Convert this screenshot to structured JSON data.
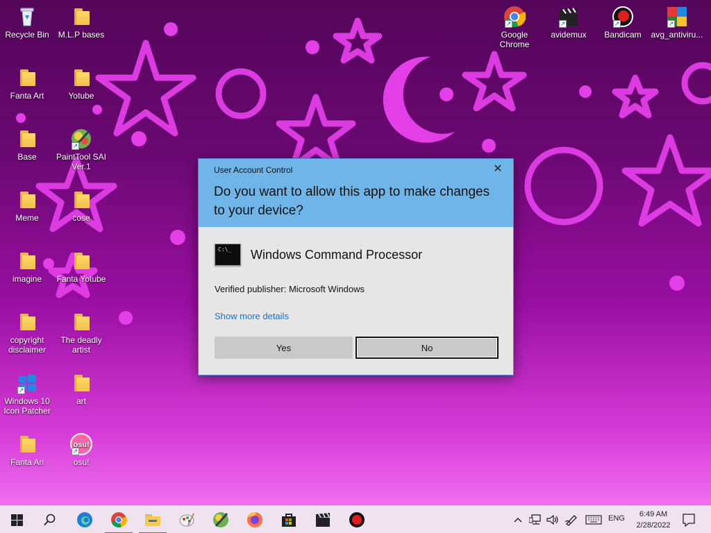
{
  "desktop": {
    "icons_left": [
      {
        "label": "Recycle Bin",
        "type": "recycle"
      },
      {
        "label": "M.L.P bases",
        "type": "folder"
      },
      {
        "label": "Fanta Art",
        "type": "folder"
      },
      {
        "label": "Yotube",
        "type": "folder"
      },
      {
        "label": "Base",
        "type": "folder"
      },
      {
        "label": "PaintTool SAI Ver.1",
        "type": "app"
      },
      {
        "label": "Meme",
        "type": "folder"
      },
      {
        "label": "cose",
        "type": "folder"
      },
      {
        "label": "imagine",
        "type": "folder"
      },
      {
        "label": "Fanta Yotube",
        "type": "folder"
      },
      {
        "label": "copyright disclaimer",
        "type": "folder"
      },
      {
        "label": "The deadly artist",
        "type": "folder"
      },
      {
        "label": "Windows 10 Icon Patcher",
        "type": "app"
      },
      {
        "label": "art",
        "type": "folder"
      },
      {
        "label": "Fanta Ari",
        "type": "folder"
      },
      {
        "label": "osu!",
        "type": "app"
      }
    ],
    "icons_right": [
      {
        "label": "Google Chrome"
      },
      {
        "label": "avidemux"
      },
      {
        "label": "Bandicam"
      },
      {
        "label": "avg_antiviru..."
      }
    ]
  },
  "uac": {
    "title": "User Account Control",
    "question": "Do you want to allow this app to make changes to your device?",
    "app_name": "Windows Command Processor",
    "publisher": "Verified publisher: Microsoft Windows",
    "more_details": "Show more details",
    "yes_label": "Yes",
    "no_label": "No",
    "cmd_text": "C:\\_"
  },
  "taskbar": {
    "pinned": [
      "start-icon",
      "search-icon",
      "edge-icon",
      "chrome-icon",
      "file-explorer-icon",
      "paint-icon",
      "paintool-sai-icon",
      "firefox-icon",
      "store-icon",
      "avidemux-icon",
      "bandicam-icon"
    ],
    "language": "ENG",
    "time": "6:49 AM",
    "date": "2/28/2022"
  },
  "colors": {
    "uac_header": "#6fb5e8",
    "uac_body": "#e6e6e6",
    "link": "#1a73c8",
    "taskbar": "#f0e3f0",
    "wallpaper_shape": "#e040e6"
  }
}
